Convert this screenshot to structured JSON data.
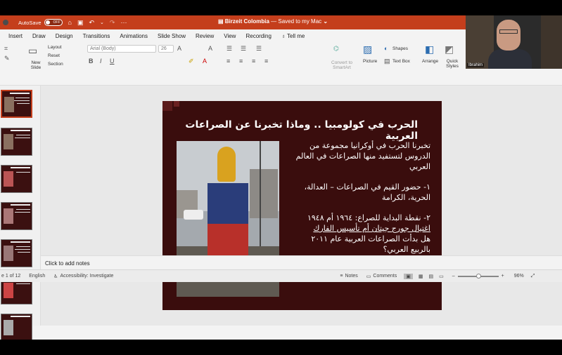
{
  "titlebar": {
    "autosave_label": "AutoSave",
    "autosave_state": "OFF",
    "doc_name": "Birzeit Colombia",
    "doc_status": "— Saved to my Mac",
    "brand_color": "#c43e1c"
  },
  "tabs": [
    "Insert",
    "Draw",
    "Design",
    "Transitions",
    "Animations",
    "Slide Show",
    "Review",
    "View",
    "Recording",
    "Tell me"
  ],
  "ribbon": {
    "layout": "Layout",
    "reset": "Reset",
    "section": "Section",
    "new_slide": "New Slide",
    "font_name": "Arial (Body)",
    "font_size": "26",
    "convert_smartart": "Convert to SmartArt",
    "picture": "Picture",
    "shapes": "Shapes",
    "text_box": "Text Box",
    "arrange": "Arrange",
    "quick_styles": "Quick Styles"
  },
  "webcam": {
    "name": "Ibrahim"
  },
  "slide": {
    "title": "الحرب في كولومبيا .. وماذا تخبرنا عن الصراعات العربية",
    "point1": "تخبرنا الحرب في أوكرانيا مجموعة من الدروس لتستفيد منها الصراعات في العالم العربي",
    "point2": "١- حضور القيم في الصراعات – العدالة، الحرية، الكرامة",
    "point3_line1": "٢- نقطة البداية للصراع: ١٩٦٤ أم ١٩٤٨",
    "point3_line2": "اغتيال جورج جيتان أم تأسيس الفارك",
    "point3_line3": "هل بدأت الصراعات العربية عام ٢٠١١ بالربيع العربي؟",
    "bg_color": "#3a0d0d"
  },
  "notes": {
    "placeholder": "Click to add notes"
  },
  "status": {
    "slide_counter": "e 1 of 12",
    "language": "English",
    "accessibility": "Accessibility: Investigate",
    "notes": "Notes",
    "comments": "Comments",
    "zoom": "96%"
  }
}
